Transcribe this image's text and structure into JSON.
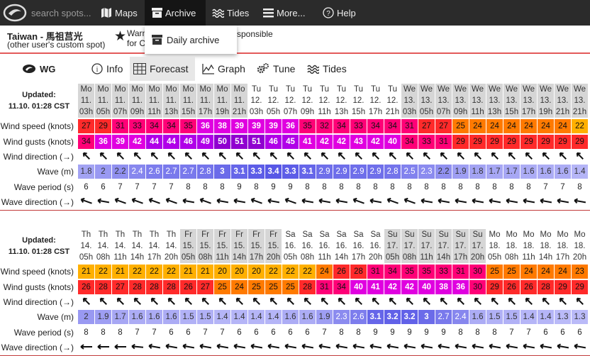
{
  "nav": {
    "search_placeholder": "search spots...",
    "maps": "Maps",
    "archive": "Archive",
    "tides": "Tides",
    "more": "More...",
    "help": "Help"
  },
  "archive_menu": {
    "daily_archive": "Daily archive"
  },
  "spot": {
    "title": "Taiwan - 馬祖莒光",
    "subtitle": "(other user's custom spot)",
    "warn_line1": "Warn",
    "warn_line2": "for C",
    "warn_resp": "sponsible"
  },
  "tabs": {
    "wg": "WG",
    "info": "Info",
    "forecast": "Forecast",
    "graph": "Graph",
    "tune": "Tune",
    "tides": "Tides"
  },
  "row_labels": {
    "wind_speed": "Wind speed (knots)",
    "wind_gusts": "Wind gusts (knots)",
    "wind_direction": "Wind direction (→)",
    "wave": "Wave (m)",
    "wave_period": "Wave period (s)",
    "wave_direction": "Wave direction (→)"
  },
  "colors": {
    "accent_red": "#c23b3b",
    "nav_bg": "#2b2b2b",
    "bold_wave": "#6f6fe8"
  },
  "tables": [
    {
      "updated_label": "Updated:",
      "updated_time": "11.10. 01:28 CST",
      "days": [
        "Mo",
        "Mo",
        "Mo",
        "Mo",
        "Mo",
        "Mo",
        "Mo",
        "Mo",
        "Mo",
        "Mo",
        "Tu",
        "Tu",
        "Tu",
        "Tu",
        "Tu",
        "Tu",
        "Tu",
        "Tu",
        "Tu",
        "We",
        "We",
        "We",
        "We",
        "We",
        "We",
        "We",
        "We",
        "We",
        "We",
        "We"
      ],
      "dates": [
        "11.",
        "11.",
        "11.",
        "11.",
        "11.",
        "11.",
        "11.",
        "11.",
        "11.",
        "11.",
        "12.",
        "12.",
        "12.",
        "12.",
        "12.",
        "12.",
        "12.",
        "12.",
        "12.",
        "13.",
        "13.",
        "13.",
        "13.",
        "13.",
        "13.",
        "13.",
        "13.",
        "13.",
        "13.",
        "13."
      ],
      "hours": [
        "03h",
        "05h",
        "07h",
        "09h",
        "11h",
        "13h",
        "15h",
        "17h",
        "19h",
        "21h",
        "03h",
        "05h",
        "07h",
        "09h",
        "11h",
        "13h",
        "15h",
        "17h",
        "21h",
        "03h",
        "05h",
        "07h",
        "09h",
        "11h",
        "13h",
        "15h",
        "17h",
        "19h",
        "21h",
        "21h"
      ],
      "shaded": [
        true,
        true,
        true,
        true,
        true,
        true,
        true,
        true,
        true,
        true,
        false,
        false,
        false,
        false,
        false,
        false,
        false,
        false,
        false,
        true,
        true,
        true,
        true,
        true,
        true,
        true,
        true,
        true,
        true,
        true
      ],
      "wind_speed": [
        27,
        29,
        31,
        33,
        34,
        34,
        35,
        36,
        38,
        39,
        39,
        39,
        36,
        35,
        32,
        34,
        33,
        34,
        34,
        31,
        27,
        27,
        25,
        24,
        24,
        24,
        24,
        24,
        24,
        22
      ],
      "wind_gusts": [
        34,
        36,
        39,
        42,
        44,
        44,
        46,
        49,
        50,
        51,
        51,
        46,
        45,
        41,
        42,
        42,
        43,
        42,
        40,
        34,
        33,
        31,
        29,
        29,
        29,
        29,
        29,
        29,
        29,
        29
      ],
      "wind_dir_deg": [
        225,
        225,
        225,
        225,
        225,
        225,
        225,
        225,
        225,
        225,
        225,
        225,
        225,
        225,
        225,
        225,
        225,
        225,
        225,
        225,
        225,
        225,
        225,
        225,
        225,
        225,
        225,
        225,
        225,
        225
      ],
      "wave": [
        "1.8",
        "2",
        "2.2",
        "2.4",
        "2.6",
        "2.7",
        "2.7",
        "2.8",
        "3",
        "3.1",
        "3.3",
        "3.4",
        "3.3",
        "3.1",
        "2.9",
        "2.9",
        "2.9",
        "2.9",
        "2.8",
        "2.5",
        "2.3",
        "2.2",
        "1.9",
        "1.8",
        "1.7",
        "1.7",
        "1.6",
        "1.6",
        "1.6",
        "1.4"
      ],
      "wave_period": [
        "6",
        "6",
        "7",
        "7",
        "7",
        "7",
        "8",
        "8",
        "8",
        "9",
        "8",
        "9",
        "9",
        "8",
        "8",
        "8",
        "8",
        "8",
        "8",
        "8",
        "8",
        "8",
        "8",
        "8",
        "8",
        "8",
        "8",
        "7",
        "7",
        "8"
      ],
      "wave_dir_deg": [
        200,
        190,
        200,
        200,
        200,
        200,
        190,
        200,
        190,
        190,
        200,
        190,
        200,
        190,
        190,
        190,
        200,
        190,
        200,
        200,
        190,
        190,
        190,
        190,
        190,
        190,
        190,
        190,
        190,
        190
      ]
    },
    {
      "updated_label": "Updated:",
      "updated_time": "11.10. 01:28 CST",
      "days": [
        "Th",
        "Th",
        "Th",
        "Th",
        "Th",
        "Th",
        "Fr",
        "Fr",
        "Fr",
        "Fr",
        "Fr",
        "Fr",
        "Sa",
        "Sa",
        "Sa",
        "Sa",
        "Sa",
        "Sa",
        "Su",
        "Su",
        "Su",
        "Su",
        "Su",
        "Su",
        "Mo",
        "Mo",
        "Mo",
        "Mo",
        "Mo",
        "Mo"
      ],
      "dates": [
        "14.",
        "14.",
        "14.",
        "14.",
        "14.",
        "14.",
        "15.",
        "15.",
        "15.",
        "15.",
        "15.",
        "15.",
        "16.",
        "16.",
        "16.",
        "16.",
        "16.",
        "16.",
        "17.",
        "17.",
        "17.",
        "17.",
        "17.",
        "17.",
        "18.",
        "18.",
        "18.",
        "18.",
        "18.",
        "18."
      ],
      "hours": [
        "05h",
        "08h",
        "11h",
        "14h",
        "17h",
        "20h",
        "05h",
        "08h",
        "11h",
        "14h",
        "17h",
        "20h",
        "05h",
        "08h",
        "11h",
        "14h",
        "17h",
        "20h",
        "05h",
        "08h",
        "11h",
        "14h",
        "17h",
        "20h",
        "05h",
        "08h",
        "11h",
        "14h",
        "17h",
        "20h"
      ],
      "shaded": [
        false,
        false,
        false,
        false,
        false,
        false,
        true,
        true,
        true,
        true,
        true,
        true,
        false,
        false,
        false,
        false,
        false,
        false,
        true,
        true,
        true,
        true,
        true,
        true,
        false,
        false,
        false,
        false,
        false,
        false
      ],
      "wind_speed": [
        21,
        22,
        21,
        22,
        22,
        22,
        21,
        21,
        20,
        20,
        20,
        22,
        22,
        22,
        24,
        26,
        28,
        31,
        34,
        35,
        35,
        33,
        31,
        30,
        25,
        25,
        24,
        24,
        24,
        23
      ],
      "wind_gusts": [
        26,
        28,
        27,
        28,
        28,
        28,
        26,
        27,
        25,
        24,
        25,
        25,
        25,
        28,
        31,
        34,
        40,
        41,
        42,
        42,
        40,
        38,
        36,
        30,
        29,
        26,
        26,
        28,
        29,
        29
      ],
      "wind_dir_deg": [
        225,
        225,
        225,
        225,
        225,
        225,
        225,
        225,
        225,
        225,
        225,
        225,
        225,
        225,
        225,
        225,
        225,
        225,
        225,
        225,
        225,
        225,
        225,
        225,
        225,
        225,
        225,
        225,
        225,
        225
      ],
      "wave": [
        "2",
        "1.9",
        "1.7",
        "1.6",
        "1.6",
        "1.6",
        "1.5",
        "1.5",
        "1.4",
        "1.4",
        "1.4",
        "1.4",
        "1.6",
        "1.6",
        "1.9",
        "2.3",
        "2.6",
        "3.1",
        "3.2",
        "3.2",
        "3",
        "2.7",
        "2.4",
        "1.6",
        "1.5",
        "1.5",
        "1.4",
        "1.4",
        "1.3",
        "1.3"
      ],
      "wave_period": [
        "8",
        "8",
        "8",
        "7",
        "7",
        "6",
        "6",
        "7",
        "7",
        "6",
        "6",
        "6",
        "6",
        "6",
        "7",
        "8",
        "8",
        "9",
        "9",
        "9",
        "9",
        "9",
        "8",
        "8",
        "8",
        "7",
        "7",
        "6",
        "6",
        "6"
      ],
      "wave_dir_deg": [
        180,
        180,
        180,
        185,
        190,
        190,
        190,
        190,
        190,
        190,
        190,
        190,
        190,
        190,
        190,
        190,
        190,
        190,
        190,
        190,
        190,
        190,
        190,
        190,
        190,
        190,
        190,
        190,
        190,
        190
      ]
    }
  ]
}
